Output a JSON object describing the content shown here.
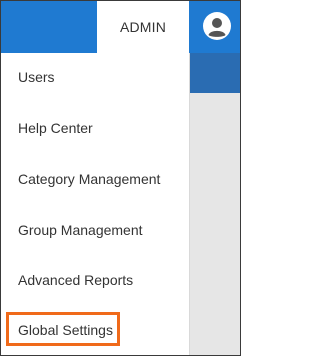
{
  "header": {
    "admin_label": "ADMIN"
  },
  "menu": {
    "items": [
      {
        "label": "Users"
      },
      {
        "label": "Help Center"
      },
      {
        "label": "Category Management"
      },
      {
        "label": "Group Management"
      },
      {
        "label": "Advanced Reports"
      },
      {
        "label": "Global Settings"
      }
    ]
  },
  "colors": {
    "header_blue": "#1f7ad1",
    "highlight_orange": "#f06a1a"
  },
  "icons": {
    "avatar": "user-avatar-icon"
  }
}
